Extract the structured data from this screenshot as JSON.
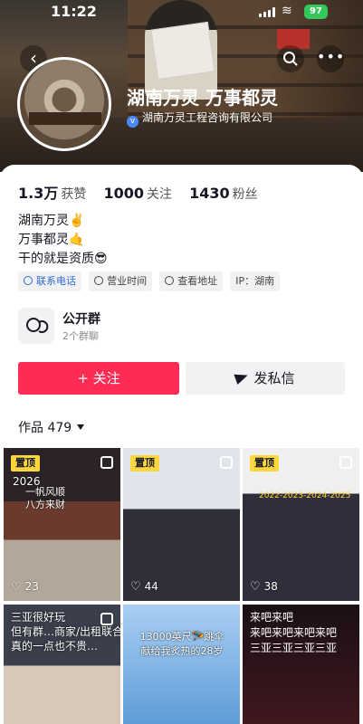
{
  "status_bar": {
    "time": "11:22",
    "battery": "97"
  },
  "profile": {
    "name": "湖南万灵 万事都灵",
    "company": "湖南万灵工程咨询有限公司"
  },
  "stats": [
    {
      "num": "1.3万",
      "label": "获赞"
    },
    {
      "num": "1000",
      "label": "关注"
    },
    {
      "num": "1430",
      "label": "粉丝"
    }
  ],
  "bio": [
    "湖南万灵✌️",
    "万事都灵🤙",
    "干的就是资质😎"
  ],
  "tags": [
    "联系电话",
    "营业时间",
    "查看地址",
    "IP：湖南"
  ],
  "group": {
    "title": "公开群",
    "subtitle": "2个群聊"
  },
  "buttons": {
    "follow": "+ 关注",
    "message": "发私信"
  },
  "works": {
    "label": "作品 479"
  },
  "tiles": [
    {
      "pin": "置顶",
      "likes": "23",
      "vertical": "2026",
      "text": [
        "一帆风顺",
        "八方来财"
      ]
    },
    {
      "pin": "置顶",
      "likes": "44"
    },
    {
      "pin": "置顶",
      "likes": "38",
      "text": "2022-2023-2024-2025"
    },
    {
      "text": [
        "三亚很好玩",
        "但有群…商家/出租联合",
        "真的一点也不贵…"
      ]
    },
    {
      "text": [
        "13000英尺🪂跳伞",
        "献给我炙热的28岁"
      ]
    },
    {
      "text": [
        "来吧来吧",
        "来吧来吧来吧来吧",
        "三亚三亚三亚三亚"
      ]
    }
  ],
  "colors": {
    "follow": "#fe2c55",
    "pin": "#fbd63f",
    "verify": "#4b89ff"
  }
}
